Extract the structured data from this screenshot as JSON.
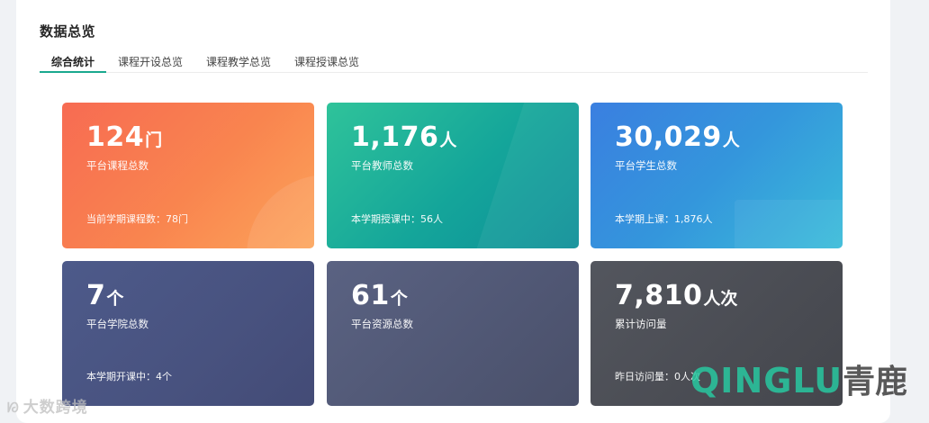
{
  "header": {
    "title": "数据总览"
  },
  "tabs": [
    {
      "label": "综合统计",
      "active": true
    },
    {
      "label": "课程开设总览",
      "active": false
    },
    {
      "label": "课程教学总览",
      "active": false
    },
    {
      "label": "课程授课总览",
      "active": false
    }
  ],
  "cards": [
    {
      "value": "124",
      "unit": "门",
      "label": "平台课程总数",
      "sub": "当前学期课程数：78门",
      "color": "#f9854f"
    },
    {
      "value": "1,176",
      "unit": "人",
      "label": "平台教师总数",
      "sub": "本学期授课中：56人",
      "color": "#14a59a"
    },
    {
      "value": "30,029",
      "unit": "人",
      "label": "平台学生总数",
      "sub": "本学期上课：1,876人",
      "color": "#3496dc"
    },
    {
      "value": "7",
      "unit": "个",
      "label": "平台学院总数",
      "sub": "本学期开课中：4个",
      "color": "#48527f"
    },
    {
      "value": "61",
      "unit": "个",
      "label": "平台资源总数",
      "sub": "",
      "color": "#505774"
    },
    {
      "value": "7,810",
      "unit": "人次",
      "label": "累计访问量",
      "sub": "昨日访问量：0人次",
      "color": "#4a4c53"
    }
  ],
  "watermarks": {
    "left": "大数跨境",
    "right_latin": "QINGLU",
    "right_cn": "青鹿"
  }
}
